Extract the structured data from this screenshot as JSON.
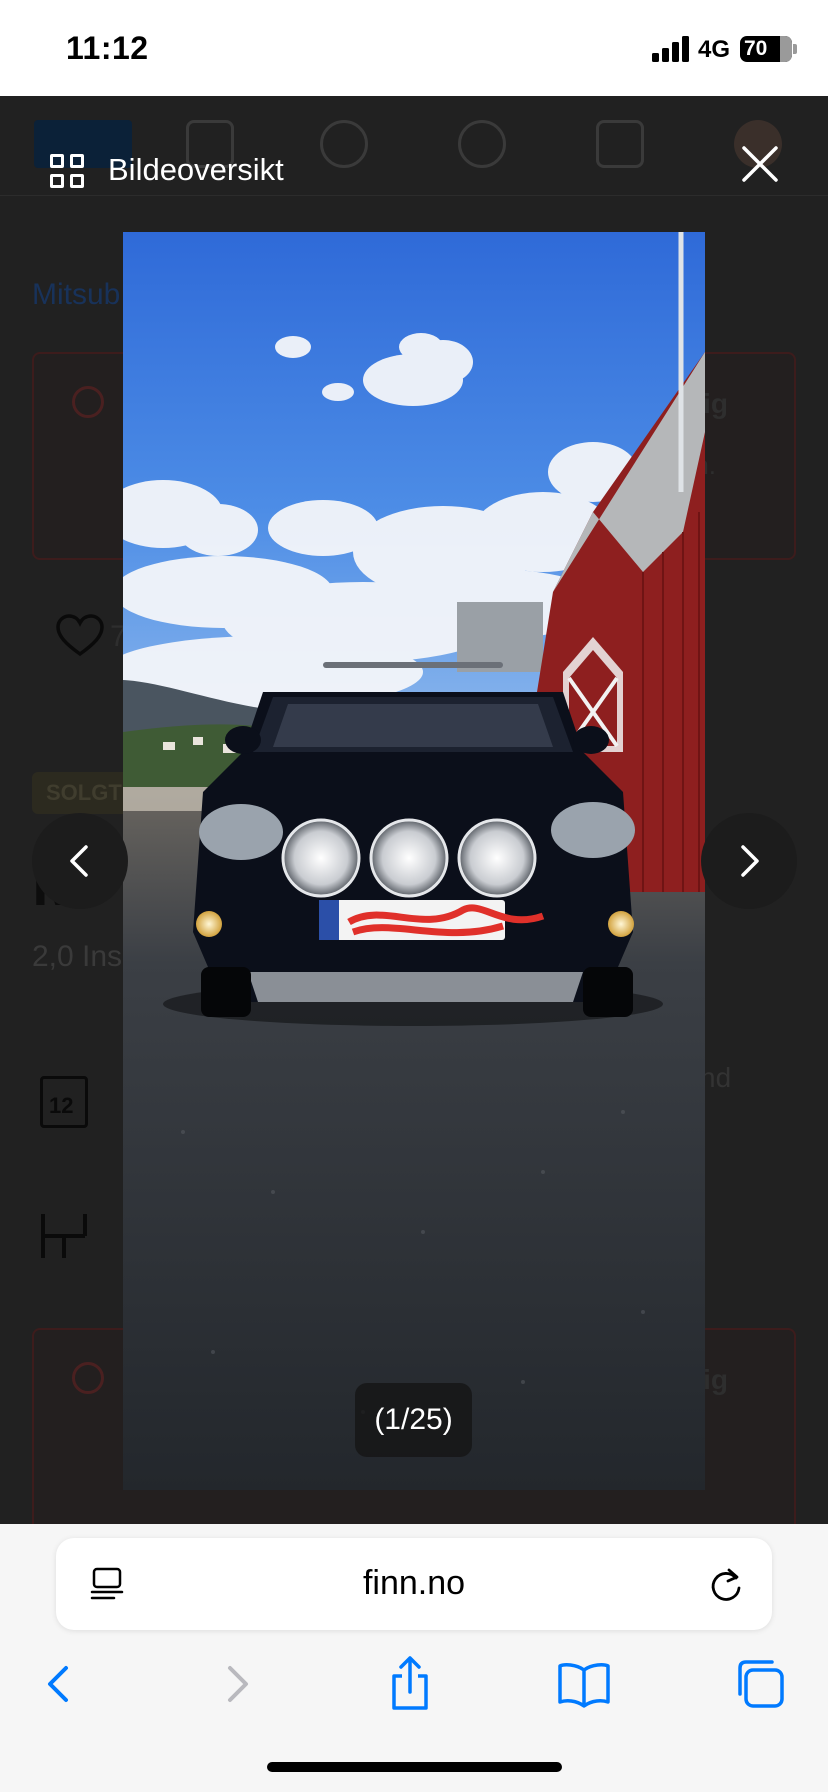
{
  "status_bar": {
    "time": "11:12",
    "network": "4G",
    "battery": "70"
  },
  "background_page": {
    "breadcrumb": "Mitsub",
    "alert_title": "ig",
    "alert_sub": "n.",
    "favorites_count": "7",
    "badge": "SOLGT",
    "title": "Mi",
    "subtitle": "2,0 Ins",
    "right_text": "nd",
    "calendar_day": "12"
  },
  "viewer": {
    "label": "Bildeoversikt",
    "counter": "(1/25)"
  },
  "browser": {
    "url": "finn.no"
  },
  "colors": {
    "accent": "#007aff"
  }
}
